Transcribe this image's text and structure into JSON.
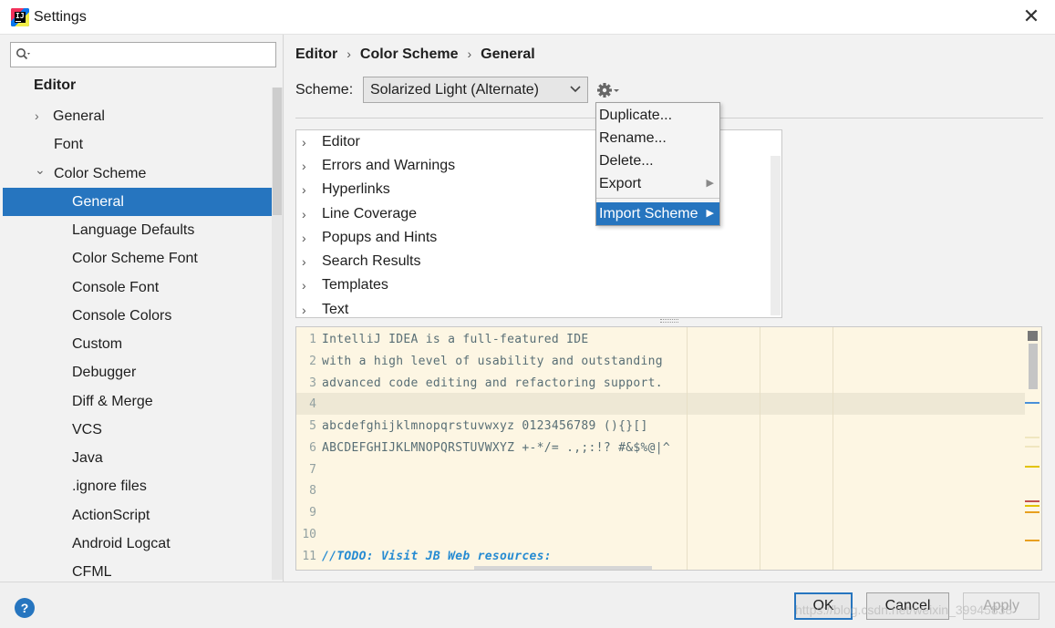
{
  "window": {
    "title": "Settings",
    "close_glyph": "✕"
  },
  "search": {
    "placeholder": "",
    "icon": "search-icon"
  },
  "sidebar": {
    "items": [
      {
        "label": "Editor",
        "level": 0,
        "bold": true
      },
      {
        "label": "General",
        "level": 1,
        "chevron": "›"
      },
      {
        "label": "Font",
        "level": 1
      },
      {
        "label": "Color Scheme",
        "level": 1,
        "chevron": "⌄"
      },
      {
        "label": "General",
        "level": 2,
        "selected": true
      },
      {
        "label": "Language Defaults",
        "level": 2
      },
      {
        "label": "Color Scheme Font",
        "level": 2
      },
      {
        "label": "Console Font",
        "level": 2
      },
      {
        "label": "Console Colors",
        "level": 2
      },
      {
        "label": "Custom",
        "level": 2
      },
      {
        "label": "Debugger",
        "level": 2
      },
      {
        "label": "Diff & Merge",
        "level": 2
      },
      {
        "label": "VCS",
        "level": 2
      },
      {
        "label": "Java",
        "level": 2
      },
      {
        "label": ".ignore files",
        "level": 2
      },
      {
        "label": "ActionScript",
        "level": 2
      },
      {
        "label": "Android Logcat",
        "level": 2
      },
      {
        "label": "CFML",
        "level": 2
      }
    ]
  },
  "breadcrumb": [
    "Editor",
    "Color Scheme",
    "General"
  ],
  "breadcrumb_sep": "›",
  "scheme": {
    "label": "Scheme:",
    "value": "Solarized Light (Alternate)"
  },
  "categories": [
    "Editor",
    "Errors and Warnings",
    "Hyperlinks",
    "Line Coverage",
    "Popups and Hints",
    "Search Results",
    "Templates",
    "Text"
  ],
  "preview": {
    "lines": [
      {
        "n": "1",
        "text": "IntelliJ IDEA is a full-featured IDE"
      },
      {
        "n": "2",
        "text": "with a high level of usability and outstanding"
      },
      {
        "n": "3",
        "text": "advanced code editing and refactoring support."
      },
      {
        "n": "4",
        "text": ""
      },
      {
        "n": "5",
        "text": "abcdefghijklmnopqrstuvwxyz 0123456789 (){}[]"
      },
      {
        "n": "6",
        "text": "ABCDEFGHIJKLMNOPQRSTUVWXYZ +-*/= .,;:!? #&$%@|^"
      },
      {
        "n": "7",
        "text": ""
      },
      {
        "n": "8",
        "text": ""
      },
      {
        "n": "9",
        "text": ""
      },
      {
        "n": "10",
        "text": ""
      },
      {
        "n": "11",
        "text": "//TODO: Visit JB Web resources:"
      }
    ],
    "colors": {
      "background": "#fdf6e3",
      "current_line": "#eee8d5",
      "comment": "#268bd2"
    }
  },
  "menu": {
    "items": [
      "Duplicate...",
      "Rename...",
      "Delete...",
      "Export",
      "Import Scheme"
    ],
    "submenu_arrow": "▶"
  },
  "buttons": {
    "ok": "OK",
    "cancel": "Cancel",
    "apply": "Apply",
    "help": "?"
  },
  "watermark": "https://blog.csdn.net/weixin_39945838",
  "accent": "#2675bf"
}
